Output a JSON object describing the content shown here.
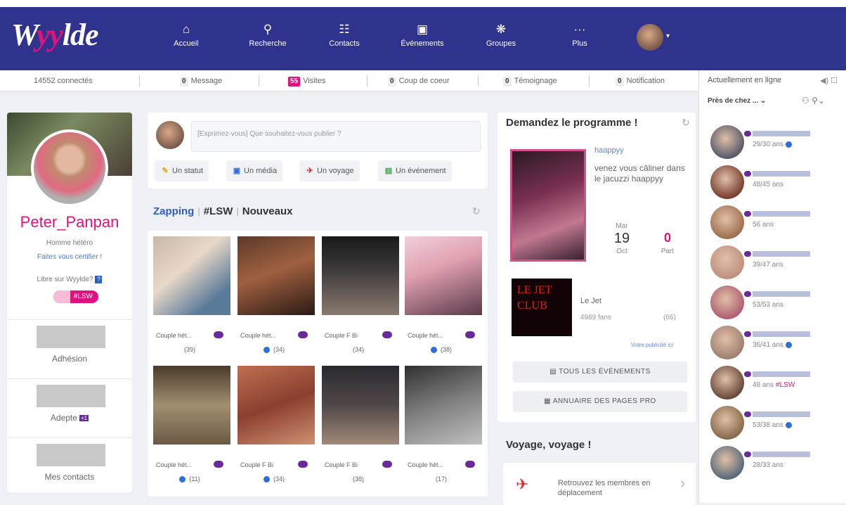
{
  "logo": {
    "pre": "W",
    "mid": "yy",
    "post": "lde"
  },
  "nav": [
    {
      "icon": "home-icon",
      "glyph": "⌂",
      "label": "Accueil"
    },
    {
      "icon": "search-icon",
      "glyph": "⚲",
      "label": "Recherche"
    },
    {
      "icon": "contacts-icon",
      "glyph": "☷",
      "label": "Contacts"
    },
    {
      "icon": "calendar-icon",
      "glyph": "▣",
      "label": "Événements"
    },
    {
      "icon": "groups-icon",
      "glyph": "❋",
      "label": "Groupes"
    },
    {
      "icon": "more-icon",
      "glyph": "···",
      "label": "Plus"
    }
  ],
  "stats": {
    "online": "14552 connectés",
    "messages": {
      "count": "0",
      "label": "Message"
    },
    "visits": {
      "count": "55",
      "label": "Visites"
    },
    "coeur": {
      "count": "0",
      "label": "Coup de coeur"
    },
    "temoignage": {
      "count": "0",
      "label": "Témoignage"
    },
    "notification": {
      "count": "0",
      "label": "Notification"
    }
  },
  "profile": {
    "name": "Peter_Panpan",
    "subtitle": "Homme hétéro",
    "certify": "Faites vous certifier !",
    "libre": "Libre sur Wyylde?",
    "libre_badge": "?",
    "tag": "#LSW",
    "blocks": [
      {
        "label": "Adhésion",
        "badge": ""
      },
      {
        "label": "Adepte",
        "badge": "+1"
      },
      {
        "label": "Mes contacts",
        "badge": ""
      }
    ]
  },
  "post": {
    "placeholder": "[Exprimez-vous] Que souhaitez-vous publier ?",
    "buttons": [
      {
        "icon": "pencil-icon",
        "glyph": "✎",
        "label": "Un statut",
        "color": "#e6a81c"
      },
      {
        "icon": "media-icon",
        "glyph": "▣",
        "label": "Un média",
        "color": "#2c6fd8"
      },
      {
        "icon": "plane-icon",
        "glyph": "✈",
        "label": "Un voyage",
        "color": "#d83030"
      },
      {
        "icon": "calendar-icon",
        "glyph": "▤",
        "label": "Un événement",
        "color": "#3aa84a"
      }
    ]
  },
  "zapping": {
    "tab1": "Zapping",
    "tab2": "#LSW",
    "tab3": "Nouveaux",
    "sep": "|"
  },
  "tiles": [
    {
      "line1": "Couple hét...",
      "line2": "(39)",
      "dot": false,
      "bg": "linear-gradient(140deg,#c8b8a8,#e8d8c8 40%,#5a7a9a 80%)"
    },
    {
      "line1": "Couple hét...",
      "line2": "(34)",
      "dot": true,
      "bg": "linear-gradient(160deg,#5a3a2a,#a06040 45%,#2a1a15)"
    },
    {
      "line1": "Couple F Bi",
      "line2": "(34)",
      "dot": false,
      "bg": "linear-gradient(180deg,#1a1a1a,#3a3838 40%,#8a7a70)"
    },
    {
      "line1": "Couple hét...",
      "line2": "(38)",
      "dot": true,
      "bg": "linear-gradient(160deg,#f0d0d8,#e0a0b0 40%,#5a3a4a)"
    },
    {
      "line1": "Couple hét...",
      "line2": "(11)",
      "dot": true,
      "bg": "linear-gradient(180deg,#4a3a2a,#a09070 50%,#6a5a45)"
    },
    {
      "line1": "Couple F Bi",
      "line2": "(34)",
      "dot": true,
      "bg": "linear-gradient(160deg,#c07050,#8a4030 50%,#d09070)"
    },
    {
      "line1": "Couple F Bi",
      "line2": "(38)",
      "dot": false,
      "bg": "linear-gradient(180deg,#2a2a30,#504848 50%,#a08878)"
    },
    {
      "line1": "Couple hét...",
      "line2": "(17)",
      "dot": false,
      "bg": "linear-gradient(160deg,#303030,#808080 50%,#c0c0c0)"
    }
  ],
  "program": {
    "title": "Demandez le programme !",
    "event_name": "haappyy",
    "event_desc": "venez vous câliner dans le jacuzzi haappyy",
    "day": "Mar",
    "date": "19",
    "month": "Oct",
    "count": "0",
    "part": "Part",
    "club_name": "Le Jet",
    "club_fans": "4989 fans",
    "club_count": "(66)",
    "club_sign": "LE JET CLUB",
    "pub": "Votre publicité ici",
    "btn1": "TOUS LES ÉVÉNEMENTS",
    "btn2": "ANNUAIRE DES PAGES PRO"
  },
  "voyage": {
    "title": "Voyage, voyage !",
    "text": "Retrouvez les membres en déplacement"
  },
  "online": {
    "title": "Actuellement en ligne",
    "filter": "Près de chez ...",
    "users": [
      {
        "age": "29/30 ans",
        "dot": true,
        "tag": ""
      },
      {
        "age": "48/45 ans",
        "dot": false,
        "tag": ""
      },
      {
        "age": "56 ans",
        "dot": false,
        "tag": ""
      },
      {
        "age": "39/47 ans",
        "dot": false,
        "tag": ""
      },
      {
        "age": "53/53 ans",
        "dot": false,
        "tag": ""
      },
      {
        "age": "36/41 ans",
        "dot": true,
        "tag": ""
      },
      {
        "age": "48 ans",
        "dot": false,
        "tag": "#LSW"
      },
      {
        "age": "53/38 ans",
        "dot": true,
        "tag": ""
      },
      {
        "age": "28/33 ans",
        "dot": false,
        "tag": ""
      }
    ]
  }
}
